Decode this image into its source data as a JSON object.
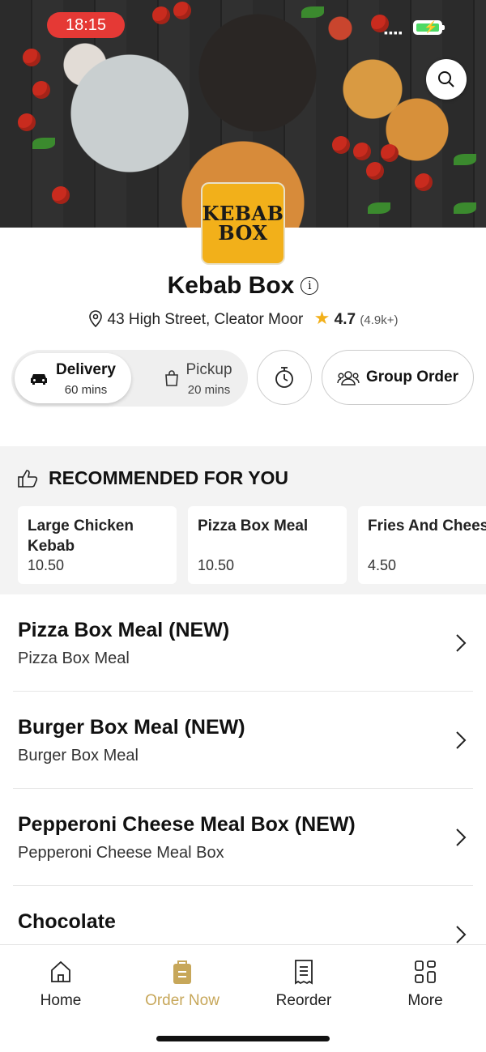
{
  "status_bar": {
    "time": "18:15"
  },
  "restaurant": {
    "logo_line1": "KEBAB",
    "logo_line2": "BOX",
    "name": "Kebab Box",
    "address": "43 High Street, Cleator Moor",
    "rating": "4.7",
    "rating_count": "(4.9k+)"
  },
  "order_modes": [
    {
      "label": "Delivery",
      "time": "60 mins",
      "selected": true
    },
    {
      "label": "Pickup",
      "time": "20 mins",
      "selected": false
    }
  ],
  "group_order_label": "Group Order",
  "recommended": {
    "heading": "RECOMMENDED FOR YOU",
    "items": [
      {
        "name": "Large Chicken Kebab",
        "price": "10.50"
      },
      {
        "name": "Pizza Box Meal",
        "price": "10.50"
      },
      {
        "name": "Fries And Cheese",
        "price": "4.50"
      }
    ]
  },
  "categories": [
    {
      "title": "Pizza Box Meal (NEW)",
      "subtitle": "Pizza Box Meal"
    },
    {
      "title": "Burger Box Meal (NEW)",
      "subtitle": "Burger Box Meal"
    },
    {
      "title": "Pepperoni Cheese Meal Box (NEW)",
      "subtitle": "Pepperoni Cheese Meal Box"
    },
    {
      "title": "Chocolate",
      "subtitle": ""
    }
  ],
  "tabs": [
    {
      "label": "Home",
      "icon": "home-icon",
      "active": false
    },
    {
      "label": "Order Now",
      "icon": "order-bag-icon",
      "active": true
    },
    {
      "label": "Reorder",
      "icon": "receipt-icon",
      "active": false
    },
    {
      "label": "More",
      "icon": "grid-icon",
      "active": false
    }
  ],
  "colors": {
    "accent": "#c7a75a",
    "status_time_bg": "#e53935",
    "logo_bg": "#f2b01a",
    "star": "#f2b01a"
  }
}
